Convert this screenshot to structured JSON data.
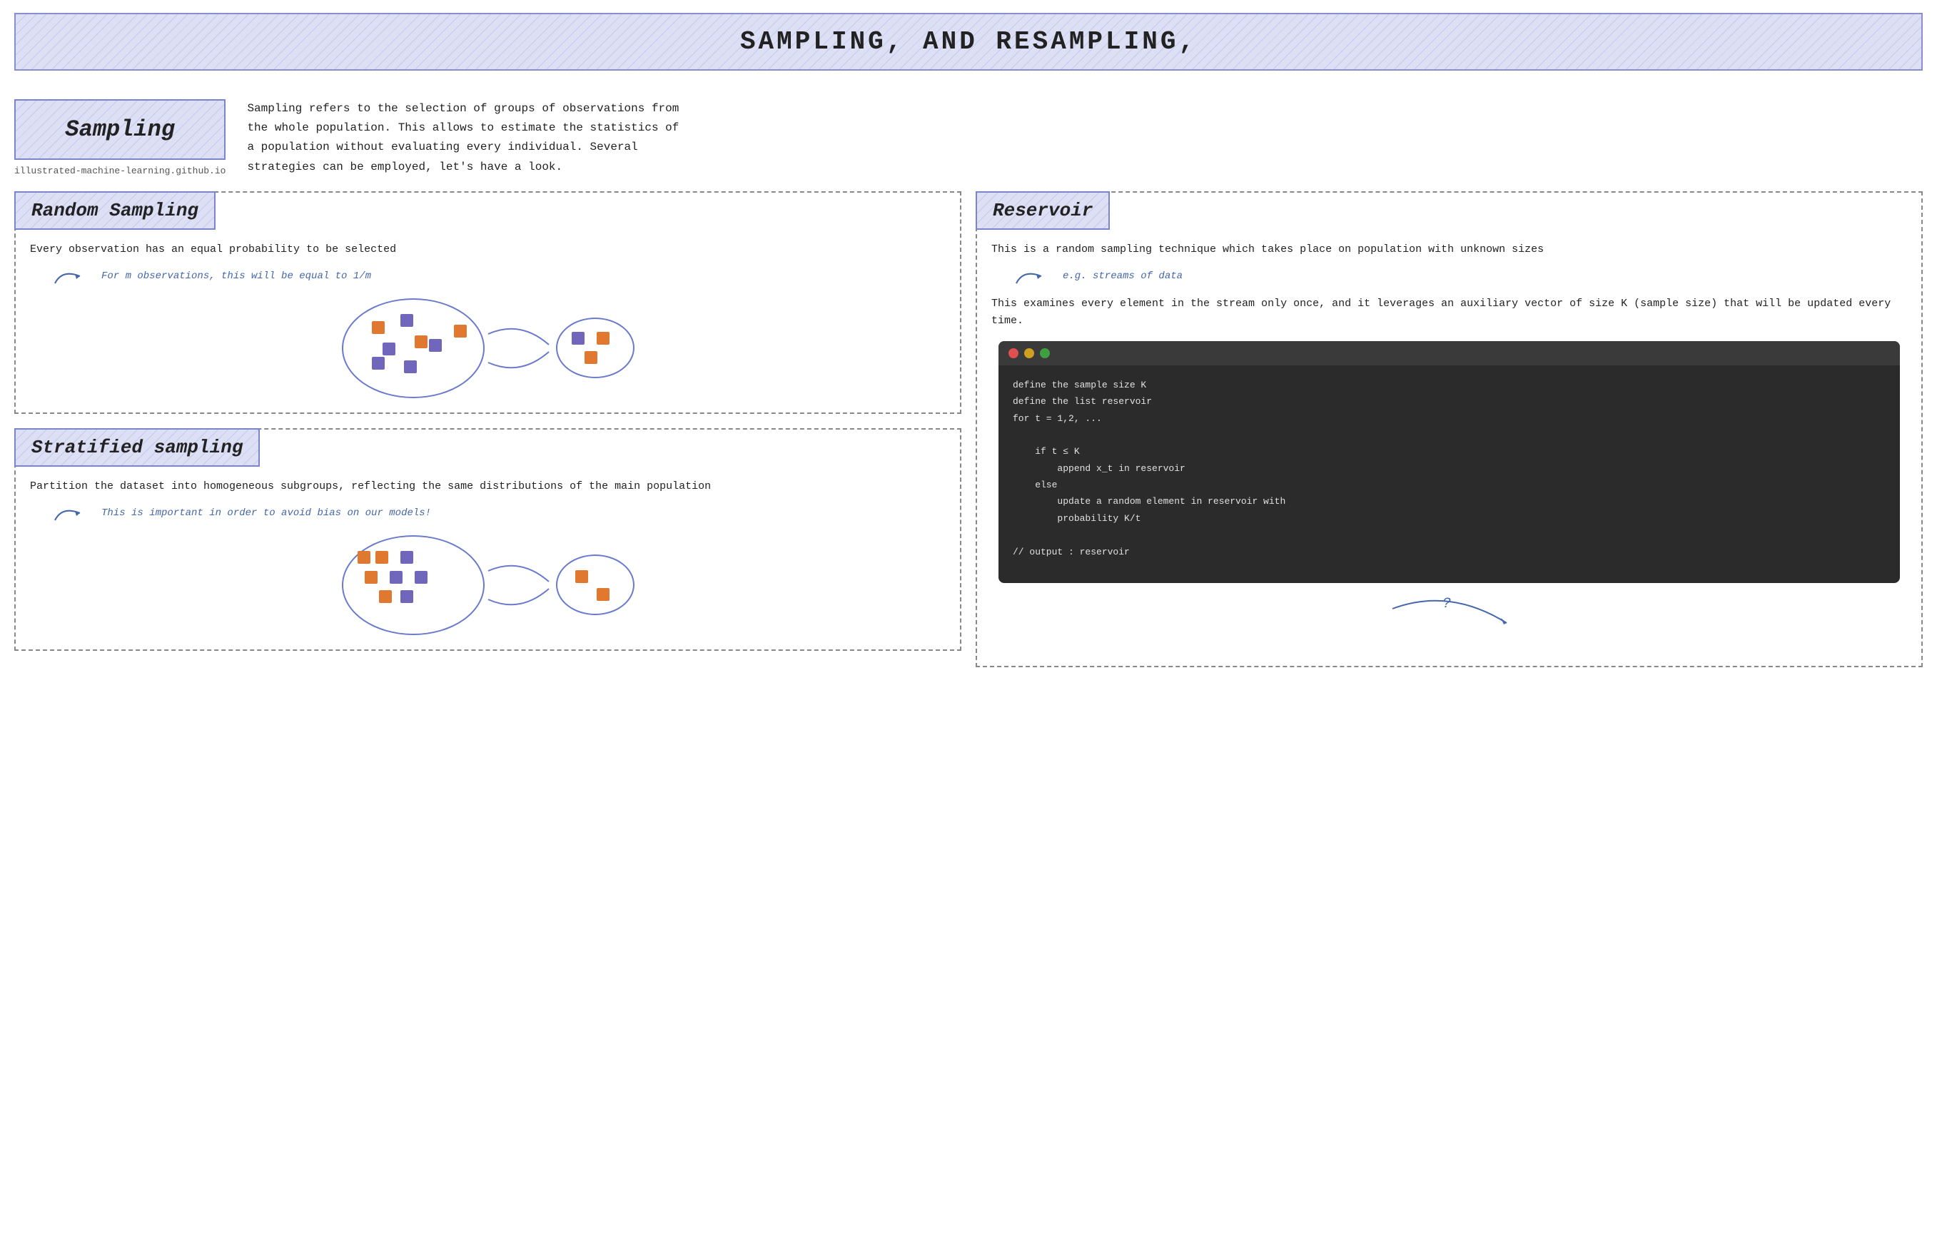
{
  "header": {
    "title": "SAMPLING, AND RESAMPLING,"
  },
  "intro": {
    "sampling_box_title": "Sampling",
    "sampling_box_subtitle": "illustrated-machine-learning.github.io",
    "description": "Sampling refers to the selection of groups of observations from the whole\npopulation. This allows to estimate the statistics of a population without\nevaluating every individual. Several strategies can be employed, let's have a look."
  },
  "random_sampling": {
    "title": "Random Sampling",
    "description": "Every observation has an equal probability to be selected",
    "arrow_text": "For m observations, this will be equal to 1/m"
  },
  "stratified_sampling": {
    "title": "Stratified sampling",
    "description": "Partition the dataset into homogeneous subgroups, reflecting the\nsame distributions of the main population",
    "arrow_text": "This is important in order to avoid bias on our models!"
  },
  "reservoir": {
    "title": "Reservoir",
    "description1": "This is a random sampling technique which takes place on population\nwith unknown sizes",
    "arrow_text": "e.g. streams of data",
    "description2": "This examines every element in the stream only once, and it leverages\nan auxiliary vector of size K (sample size) that will be updated every\ntime.",
    "code": "define the sample size K\ndefine the list reservoir\nfor t = 1,2, ...\n\n    if t ≤ K\n        append x_t in reservoir\n    else\n        update a random element in reservoir with\n        probability K/t\n\n// output : reservoir"
  }
}
